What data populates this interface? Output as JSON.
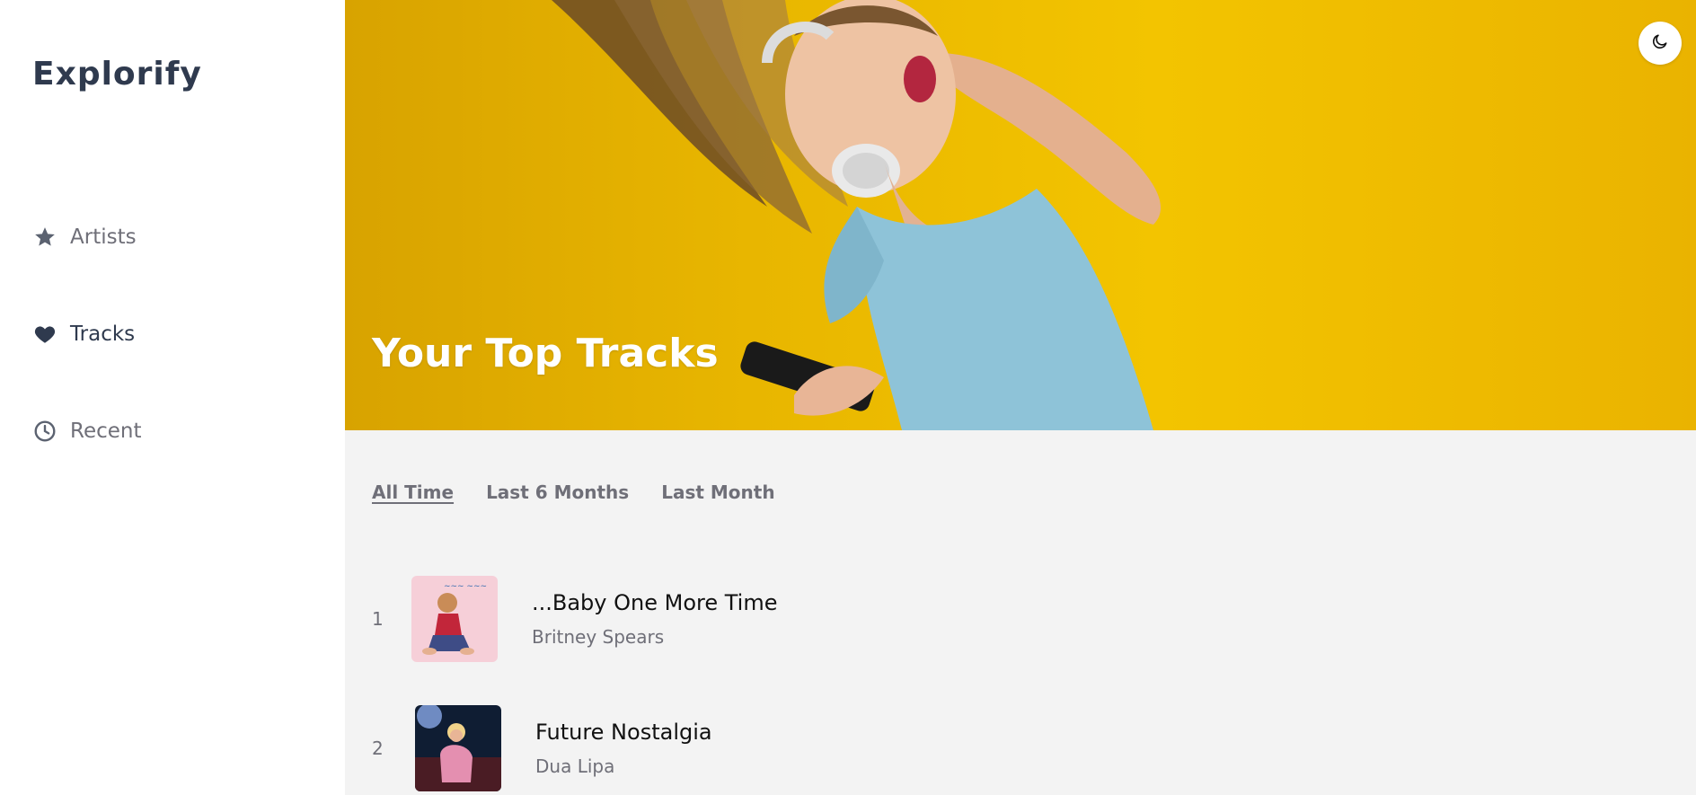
{
  "app": {
    "brand": "Explorify"
  },
  "sidebar": {
    "items": [
      {
        "label": "Artists",
        "icon": "star-icon"
      },
      {
        "label": "Tracks",
        "icon": "heart-icon",
        "active": true
      },
      {
        "label": "Recent",
        "icon": "clock-icon"
      }
    ]
  },
  "hero": {
    "title": "Your Top Tracks"
  },
  "theme_toggle": {
    "icon": "moon-icon"
  },
  "tabs": [
    {
      "label": "All Time",
      "active": true
    },
    {
      "label": "Last 6 Months"
    },
    {
      "label": "Last Month"
    }
  ],
  "tracks": [
    {
      "rank": "1",
      "title": "...Baby One More Time",
      "artist": "Britney Spears"
    },
    {
      "rank": "2",
      "title": "Future Nostalgia",
      "artist": "Dua Lipa"
    }
  ],
  "colors": {
    "accent_text": "#2f3a4e",
    "muted_text": "#6f6f78",
    "hero_bg": "#f3c400",
    "content_bg": "#f3f3f3"
  }
}
